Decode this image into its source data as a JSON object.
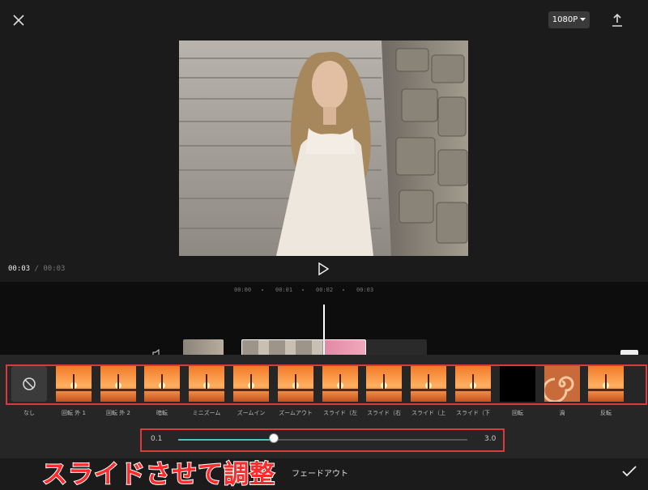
{
  "header": {
    "close_icon": "close-icon",
    "resolution_label": "1080P",
    "export_icon": "export-icon"
  },
  "player": {
    "current_time": "00:03",
    "separator": " / ",
    "total_time": "00:03",
    "play_icon": "play-icon"
  },
  "timeline": {
    "ticks": [
      "00:00",
      "00:01",
      "00:02",
      "00:03"
    ]
  },
  "transitions": [
    {
      "label": "なし",
      "kind": "none"
    },
    {
      "label": "回転 外 1",
      "kind": "orange"
    },
    {
      "label": "回転 外 2",
      "kind": "orange"
    },
    {
      "label": "暗転",
      "kind": "orange"
    },
    {
      "label": "ミニズーム",
      "kind": "orange"
    },
    {
      "label": "ズームイン",
      "kind": "orange"
    },
    {
      "label": "ズームアウト",
      "kind": "orange"
    },
    {
      "label": "スライド（左",
      "kind": "orange"
    },
    {
      "label": "スライド（右",
      "kind": "orange"
    },
    {
      "label": "スライド（上",
      "kind": "orange"
    },
    {
      "label": "スライド（下",
      "kind": "orange"
    },
    {
      "label": "回転",
      "kind": "black"
    },
    {
      "label": "渦",
      "kind": "swirl"
    },
    {
      "label": "反転",
      "kind": "orange"
    }
  ],
  "duration_slider": {
    "min_label": "0.1",
    "max_label": "3.0",
    "fraction": 0.33
  },
  "bottom_bar": {
    "selected_label": "フェードアウト",
    "confirm_icon": "check-icon"
  },
  "overlay_caption": "スライドさせて調整",
  "colors": {
    "accent": "#3fc6c9",
    "highlight_border": "#d93a3a",
    "caption": "#ff2b2b"
  }
}
